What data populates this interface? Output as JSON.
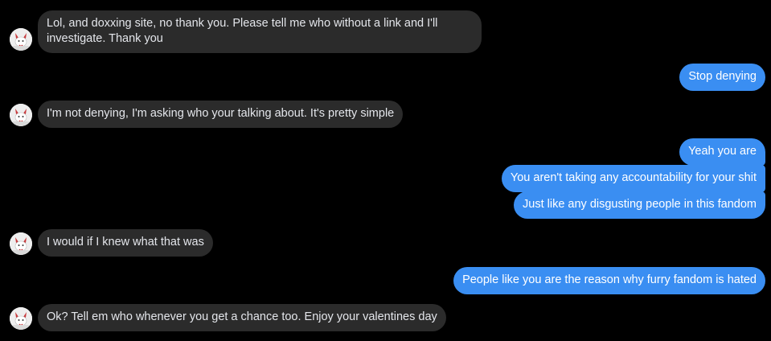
{
  "messages": [
    {
      "side": "in",
      "lines": [
        "Lol, and doxxing site, no thank you. Please tell me who without a link and I'll",
        "investigate. Thank you"
      ]
    },
    {
      "side": "out",
      "text": "Stop denying"
    },
    {
      "side": "in",
      "text": "I'm not denying, I'm asking who your talking about. It's pretty simple"
    },
    {
      "side": "out",
      "text": "Yeah you are"
    },
    {
      "side": "out",
      "text": "You aren't taking any accountability for your shit"
    },
    {
      "side": "out",
      "text": "Just like any disgusting people in this fandom"
    },
    {
      "side": "in",
      "text": "I would if I knew what that was"
    },
    {
      "side": "out",
      "text": "People like you are the reason why furry fandom is hated"
    },
    {
      "side": "in",
      "text": "Ok? Tell em who whenever you get a chance too. Enjoy your valentines day"
    }
  ],
  "avatar": {
    "icon": "fox-avatar-icon",
    "accent": "#c8383b"
  },
  "colors": {
    "background": "#000000",
    "incoming_bubble": "#2b2b2b",
    "outgoing_bubble": "#3a8ef2"
  }
}
